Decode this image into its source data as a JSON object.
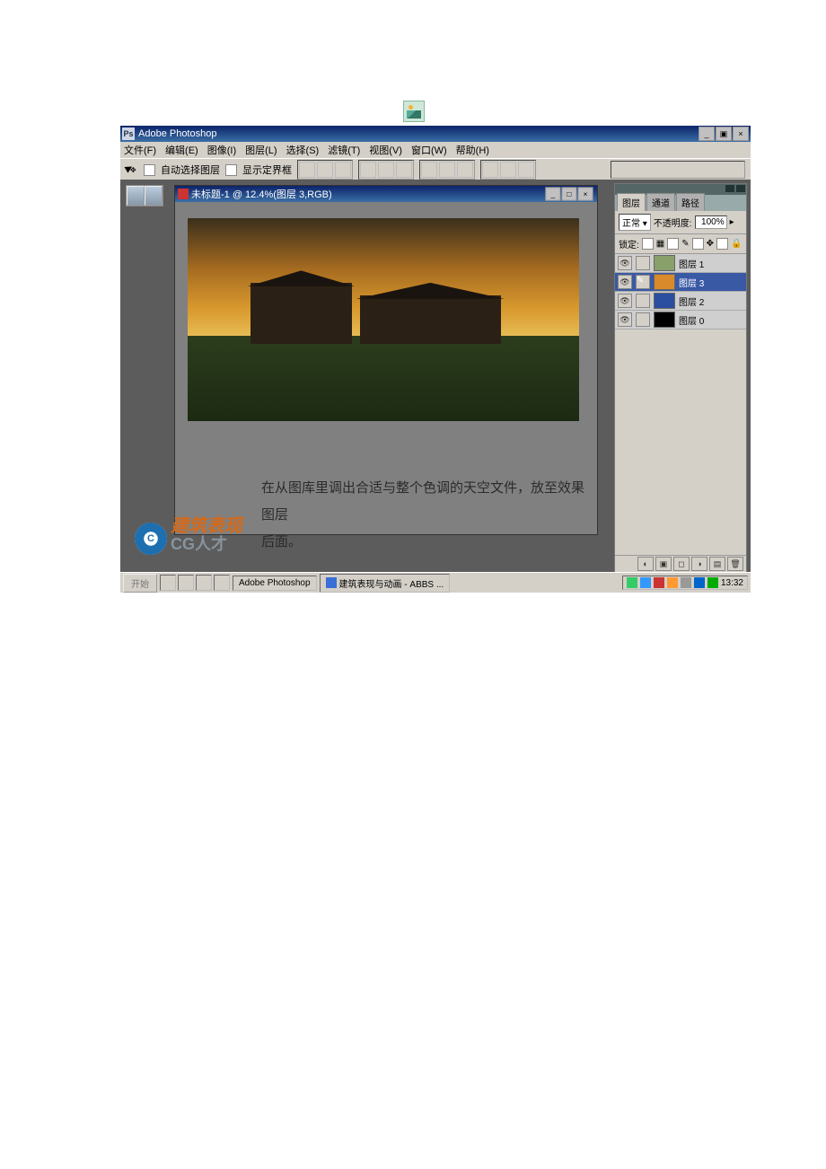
{
  "app_title": "Adobe Photoshop",
  "menu": {
    "file": "文件(F)",
    "edit": "编辑(E)",
    "image": "图像(I)",
    "layer": "图层(L)",
    "select": "选择(S)",
    "filter": "滤镜(T)",
    "view": "视图(V)",
    "window": "窗口(W)",
    "help": "帮助(H)"
  },
  "options": {
    "auto_select": "自动选择图层",
    "show_bounds": "显示定界框"
  },
  "doc_title": "未标题-1 @ 12.4%(图层 3,RGB)",
  "caption_line1": "在从图库里调出合适与整个色调的天空文件，放至效果图层",
  "caption_line2": "后面。",
  "panel": {
    "tabs": {
      "layers": "图层",
      "channels": "通道",
      "paths": "路径"
    },
    "blend": "正常",
    "opac_label": "不透明度:",
    "opac_value": "100%",
    "lock_label": "锁定:",
    "items": [
      {
        "name": "图层 1",
        "thumb": "#8aa06a",
        "sel": false
      },
      {
        "name": "图层 3",
        "thumb": "#d98a2a",
        "sel": true
      },
      {
        "name": "图层 2",
        "thumb": "#2a4fa0",
        "sel": false
      },
      {
        "name": "图层 0",
        "thumb": "#000",
        "sel": false
      }
    ]
  },
  "taskbar": {
    "start": "开始",
    "task1": "Adobe Photoshop",
    "task2": "建筑表现与动画 - ABBS ...",
    "clock": "13:32"
  },
  "watermark": {
    "line1": "建筑表现",
    "line2": "CG人才"
  }
}
